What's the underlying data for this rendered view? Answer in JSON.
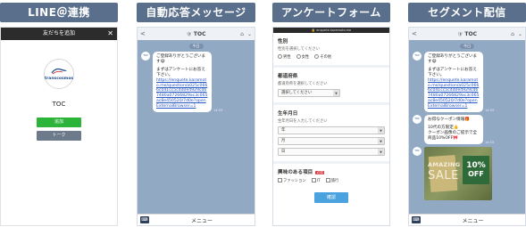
{
  "titles": [
    "LINE＠連携",
    "自動応答メッセージ",
    "アンケートフォーム",
    "セグメント配信"
  ],
  "add_friend": {
    "header": "友だちを追加",
    "close_glyph": "✕",
    "logo_text": "transcosmos",
    "name": "TOC",
    "add_label": "追加",
    "talk_label": "トーク"
  },
  "chat": {
    "title": "TOC",
    "shield_glyph": "🛡",
    "back_glyph": "<",
    "home_glyph": "⌂",
    "dropdown_glyph": "⌄",
    "day_badge": "今日",
    "avatar_text": "TOC",
    "greeting_line1": "ご登録ありがとうございます😄",
    "greeting_line2": "まずはアンケートにお答え下さい。",
    "survey_link": "https://enquete.karamoto.me/question/a025c0666c041cc5c4d0e4929cd67480a07266829ac3c065ac8e450520/7d0e?openExternalBrowser=1",
    "coupon_line1": "お得なクーポン情報🎁",
    "coupon_line2": "10代の方限定👍",
    "coupon_line3": "クーポン画像のご提示で全商品10%OFF🎀",
    "msg_time": "14:33",
    "coupon_img_amazing": "AMAZING",
    "coupon_img_sale": "SALE",
    "coupon_img_pct": "10%",
    "coupon_img_off": "OFF",
    "keyboard_glyph": "⌨",
    "menu_label": "メニュー"
  },
  "survey": {
    "url": "🔒 enquete.karamoto.me",
    "gender_label": "性別",
    "gender_hint": "性別を選択してください",
    "gender_options": [
      "男性",
      "女性",
      "その他"
    ],
    "pref_label": "都道府県",
    "pref_hint": "都道府県を選択してください",
    "pref_placeholder": "選択してください",
    "birth_label": "生年月日",
    "birth_hint": "生年月日を入力してください",
    "birth_year": "年",
    "birth_month": "月",
    "birth_day": "日",
    "interest_label": "興味のある項目",
    "required_badge": "必須",
    "interest_options": [
      "ファッション",
      "IT",
      "旅行"
    ],
    "select_arrow": "▼",
    "submit_label": "確認"
  }
}
